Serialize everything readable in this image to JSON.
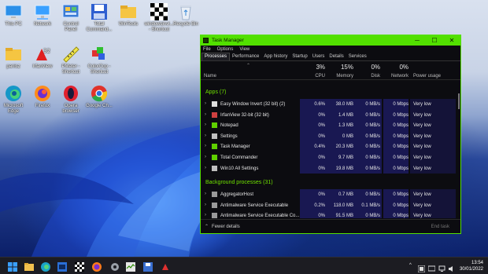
{
  "desktop": {
    "icons": [
      {
        "label": "This PC",
        "icon": "monitor-icon"
      },
      {
        "label": "Network",
        "icon": "network-icon"
      },
      {
        "label": "Control\nPanel",
        "icon": "control-panel-icon"
      },
      {
        "label": "Total\nCommand...",
        "icon": "floppy-icon"
      },
      {
        "label": "WinTools",
        "icon": "folder-icon"
      },
      {
        "label": "windowsinvi...\n- Shortcut",
        "icon": "checker-icon"
      },
      {
        "label": "Recycle Bin",
        "icon": "recycle-bin-icon"
      },
      {
        "label": "panisz",
        "icon": "folder-icon"
      },
      {
        "label": "IrfanView",
        "icon": "irfanview-icon"
      },
      {
        "label": "PMeter -\nShortcut",
        "icon": "ruler-icon"
      },
      {
        "label": "ColorCop -\nShortcut",
        "icon": "colorcop-icon"
      },
      {
        "label": "Microsoft\nEdge",
        "icon": "edge-icon"
      },
      {
        "label": "Firefox",
        "icon": "firefox-icon"
      },
      {
        "label": "Opera\nbrowser",
        "icon": "opera-icon"
      },
      {
        "label": "Google Ch...",
        "icon": "chrome-icon"
      }
    ]
  },
  "task_manager": {
    "title": "Task Manager",
    "window_controls": {
      "minimize": "─",
      "maximize": "☐",
      "close": "✕"
    },
    "menu": [
      "File",
      "Options",
      "View"
    ],
    "tabs": [
      "Processes",
      "Performance",
      "App history",
      "Startup",
      "Users",
      "Details",
      "Services"
    ],
    "active_tab": "Processes",
    "columns": {
      "name": "Name",
      "cpu": {
        "label": "CPU",
        "total": "3%"
      },
      "memory": {
        "label": "Memory",
        "total": "15%"
      },
      "disk": {
        "label": "Disk",
        "total": "0%"
      },
      "network": {
        "label": "Network",
        "total": "0%"
      },
      "power": {
        "label": "Power usage"
      }
    },
    "groups": {
      "apps": "Apps (7)",
      "background": "Background processes (31)"
    },
    "apps": [
      {
        "name": "Easy Window Invert (32 bit) (2)",
        "cpu": "0.6%",
        "memory": "38.0 MB",
        "disk": "0 MB/s",
        "network": "0 Mbps",
        "power": "Very low",
        "icon": "invert-app-icon",
        "color": "#dddddd"
      },
      {
        "name": "IrfanView 32-bit (32 bit)",
        "cpu": "0%",
        "memory": "1.4 MB",
        "disk": "0 MB/s",
        "network": "0 Mbps",
        "power": "Very low",
        "icon": "irfanview-icon",
        "color": "#d04040"
      },
      {
        "name": "Notepad",
        "cpu": "0%",
        "memory": "1.3 MB",
        "disk": "0 MB/s",
        "network": "0 Mbps",
        "power": "Very low",
        "icon": "notepad-icon",
        "color": "#5fd000"
      },
      {
        "name": "Settings",
        "cpu": "0%",
        "memory": "0 MB",
        "disk": "0 MB/s",
        "network": "0 Mbps",
        "power": "Very low",
        "icon": "gear-icon",
        "color": "#c0c0c0"
      },
      {
        "name": "Task Manager",
        "cpu": "0.4%",
        "memory": "20.3 MB",
        "disk": "0 MB/s",
        "network": "0 Mbps",
        "power": "Very low",
        "icon": "task-manager-icon",
        "color": "#5fd000"
      },
      {
        "name": "Total Commander",
        "cpu": "0%",
        "memory": "9.7 MB",
        "disk": "0 MB/s",
        "network": "0 Mbps",
        "power": "Very low",
        "icon": "floppy-icon",
        "color": "#5fd000"
      },
      {
        "name": "Win10 All Settings",
        "cpu": "0%",
        "memory": "19.8 MB",
        "disk": "0 MB/s",
        "network": "0 Mbps",
        "power": "Very low",
        "icon": "settings-grid-icon",
        "color": "#c0c0c0"
      }
    ],
    "background": [
      {
        "name": "AggregatorHost",
        "cpu": "0%",
        "memory": "0.7 MB",
        "disk": "0 MB/s",
        "network": "0 Mbps",
        "power": "Very low",
        "icon": "process-icon",
        "color": "#9a9a9a"
      },
      {
        "name": "Antimalware Service Executable",
        "cpu": "0.2%",
        "memory": "118.0 MB",
        "disk": "0.1 MB/s",
        "network": "0 Mbps",
        "power": "Very low",
        "icon": "shield-icon",
        "color": "#9a9a9a"
      },
      {
        "name": "Antimalware Service Executable Co...",
        "cpu": "0%",
        "memory": "91.5 MB",
        "disk": "0 MB/s",
        "network": "0 Mbps",
        "power": "Very low",
        "icon": "shield-icon",
        "color": "#9a9a9a"
      }
    ],
    "footer": {
      "fewer_details": "Fewer details",
      "end_task": "End task"
    }
  },
  "taskbar": {
    "clock_time": "13:54",
    "clock_date": "30/01/2022",
    "tray_chevron": "^"
  },
  "colors": {
    "accent": "#52e000",
    "highlight": "#1b1a5a",
    "group_text": "#6fe000"
  }
}
